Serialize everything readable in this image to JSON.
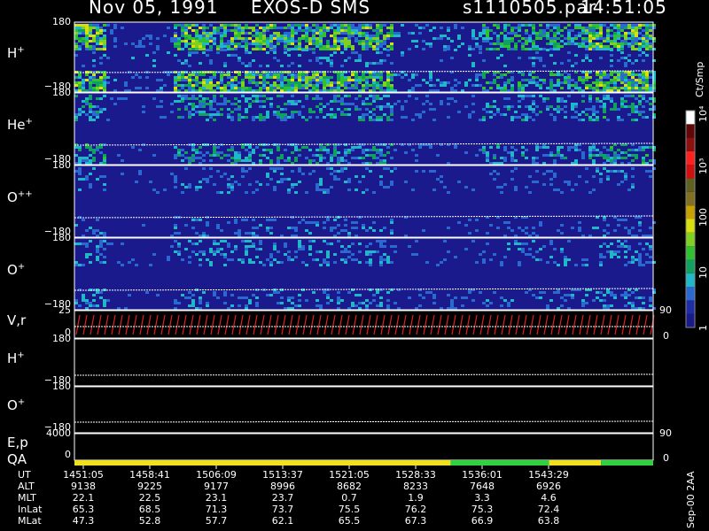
{
  "header": {
    "date": "Nov 05, 1991",
    "mission": "EXOS-D SMS",
    "file": "s1110505.par",
    "time": "14:51:05"
  },
  "panels": [
    {
      "id": "h_plus",
      "label": "H",
      "sup": "+",
      "top_tick": "180",
      "bottom_tick": "−180",
      "kind": "spectro"
    },
    {
      "id": "he_plus",
      "label": "He",
      "sup": "+",
      "top_tick": "180",
      "bottom_tick": "−180",
      "kind": "spectro"
    },
    {
      "id": "o_plus_plus",
      "label": "O",
      "sup": "++",
      "top_tick": "180",
      "bottom_tick": "−180",
      "kind": "spectro"
    },
    {
      "id": "o_plus",
      "label": "O",
      "sup": "+",
      "top_tick": "180",
      "bottom_tick": "−180",
      "kind": "spectro"
    },
    {
      "id": "v_r",
      "label": "V,r",
      "sup": "",
      "top_tick": "25",
      "bottom_tick": "0",
      "right_top": "90",
      "right_bottom": "0",
      "kind": "vr"
    },
    {
      "id": "h_plus_2",
      "label": "H",
      "sup": "+",
      "top_tick": "180",
      "bottom_tick": "−180",
      "kind": "line"
    },
    {
      "id": "o_plus_2",
      "label": "O",
      "sup": "+",
      "top_tick": "180",
      "bottom_tick": "−180",
      "kind": "line"
    },
    {
      "id": "e_p",
      "label": "E,p",
      "sup": "",
      "top_tick": "4000",
      "bottom_tick": "0",
      "right_top": "90",
      "right_bottom": "0",
      "kind": "ep"
    }
  ],
  "qa_label": "QA",
  "table": {
    "rows": [
      {
        "label": "UT",
        "values": [
          "1451:05",
          "1458:41",
          "1506:09",
          "1513:37",
          "1521:05",
          "1528:33",
          "1536:01",
          "1543:29"
        ]
      },
      {
        "label": "ALT",
        "values": [
          "9138",
          "9225",
          "9177",
          "8996",
          "8682",
          "8233",
          "7648",
          "6926"
        ]
      },
      {
        "label": "MLT",
        "values": [
          "22.1",
          "22.5",
          "23.1",
          "23.7",
          "0.7",
          "1.9",
          "3.3",
          "4.6"
        ]
      },
      {
        "label": "InLat",
        "values": [
          "65.3",
          "68.5",
          "71.3",
          "73.7",
          "75.5",
          "76.2",
          "75.3",
          "72.4"
        ]
      },
      {
        "label": "MLat",
        "values": [
          "47.3",
          "52.8",
          "57.7",
          "62.1",
          "65.5",
          "67.3",
          "66.9",
          "63.8"
        ]
      }
    ]
  },
  "colorbar": {
    "unit_label": "Ct/Smp",
    "tick_labels": [
      "1",
      "10",
      "100",
      "10³",
      "10⁴"
    ],
    "colors": [
      "#1a1a8c",
      "#1f2ea8",
      "#2a6ad0",
      "#20b8c8",
      "#10a060",
      "#30c030",
      "#80d020",
      "#d8e010",
      "#c8a000",
      "#807020",
      "#606020",
      "#d01010",
      "#ff2020",
      "#901010",
      "#600808",
      "#ffffff"
    ]
  },
  "footer_vertical": "Sep-00  2AA",
  "chart_data": {
    "type": "heatmap",
    "title": "Nov 05, 1991   EXOS-D SMS",
    "x_ticks": [
      "1451:05",
      "1458:41",
      "1506:09",
      "1513:37",
      "1521:05",
      "1528:33",
      "1536:01",
      "1543:29"
    ],
    "series": [
      {
        "name": "H+",
        "y_range": [
          -180,
          180
        ]
      },
      {
        "name": "He+",
        "y_range": [
          -180,
          180
        ]
      },
      {
        "name": "O++",
        "y_range": [
          -180,
          180
        ]
      },
      {
        "name": "O+",
        "y_range": [
          -180,
          180
        ]
      },
      {
        "name": "V,r",
        "y_range": [
          0,
          25
        ]
      },
      {
        "name": "E,p",
        "y_range": [
          0,
          4000
        ]
      }
    ],
    "colorscale": "Ct/Smp",
    "color_range": [
      "1",
      "10⁴"
    ],
    "qa_segments": [
      {
        "from": 0.0,
        "to": 0.65,
        "color": "#f0e020"
      },
      {
        "from": 0.65,
        "to": 0.82,
        "color": "#30d040"
      },
      {
        "from": 0.82,
        "to": 0.91,
        "color": "#f0e020"
      },
      {
        "from": 0.91,
        "to": 1.0,
        "color": "#30d040"
      }
    ]
  }
}
